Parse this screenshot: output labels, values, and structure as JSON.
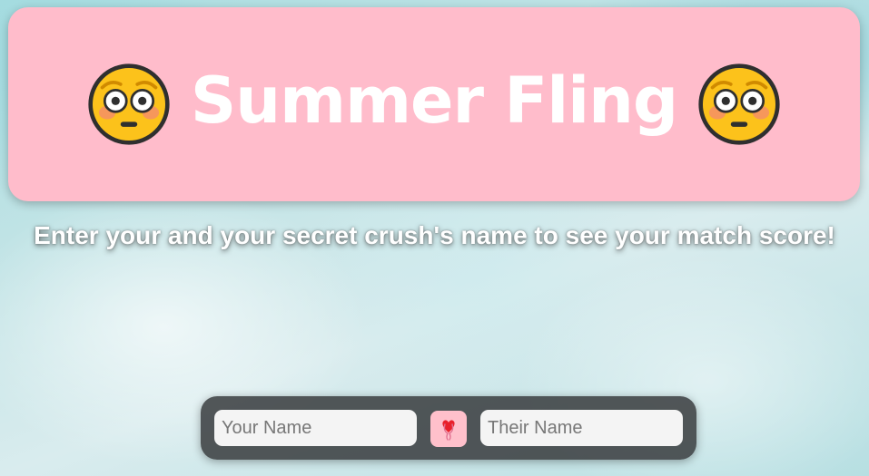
{
  "header": {
    "title": "Summer Fling",
    "left_icon": "flushed-face-icon",
    "right_icon": "flushed-face-icon"
  },
  "instructions": {
    "text": "Enter your and your secret crush's name to see your match score!"
  },
  "form": {
    "your_name": {
      "placeholder": "Your Name",
      "value": ""
    },
    "their_name": {
      "placeholder": "Their Name",
      "value": ""
    },
    "submit_icon": "heart-icon"
  },
  "colors": {
    "banner": "#ffbccb",
    "heart_button": "#ffc0cb",
    "input_bar": "#3c4042",
    "text": "#ffffff"
  }
}
